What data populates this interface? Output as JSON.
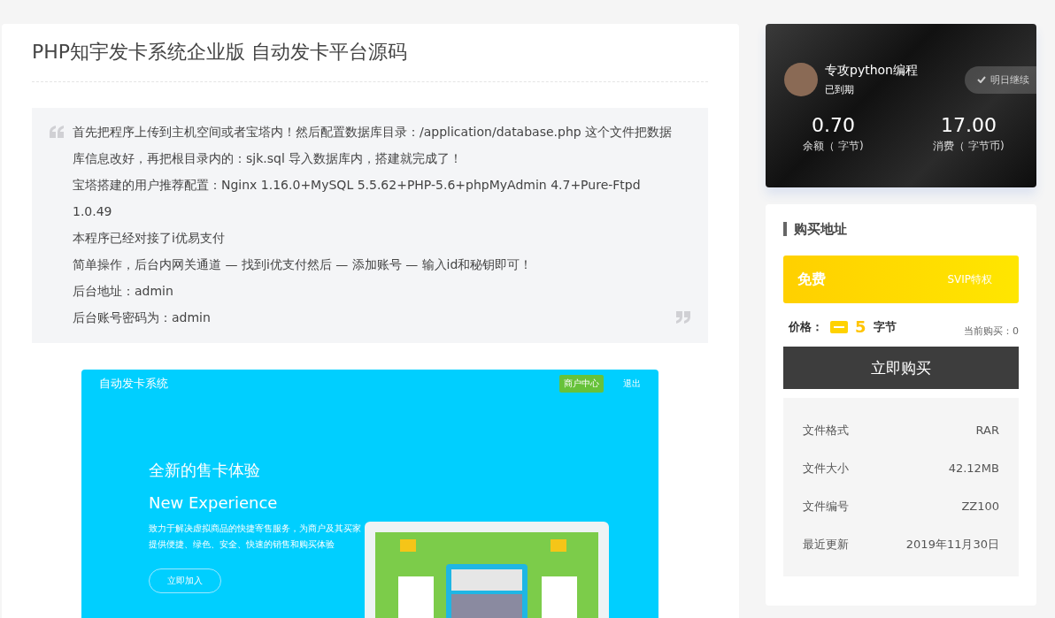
{
  "article": {
    "title": "PHP知宇发卡系统企业版 自动发卡平台源码",
    "quote_lines": [
      "首先把程序上传到主机空间或者宝塔内！然后配置数据库目录：/application/database.php 这个文件把数据库信息改好，再把根目录内的：sjk.sql 导入数据库内，搭建就完成了！",
      "宝塔搭建的用户推荐配置：Nginx 1.16.0+MySQL 5.5.62+PHP-5.6+phpMyAdmin 4.7+Pure-Ftpd 1.0.49",
      "本程序已经对接了i优易支付",
      "简单操作，后台内网关通道 — 找到i优支付然后 — 添加账号 — 输入id和秘钥即可！",
      "后台地址：admin",
      "后台账号密码为：admin"
    ],
    "shot": {
      "logo": "自动发卡系统",
      "merchant_button": "商户中心",
      "logout": "退出",
      "headline": "全新的售卡体验",
      "subheadline": "New Experience",
      "description": "致力于解决虚拟商品的快捷寄售服务，为商户及其买家提供便捷、绿色、安全、快速的销售和购买体验",
      "join_button": "立即加入"
    }
  },
  "user": {
    "name": "专攻python编程",
    "status": "已到期",
    "checkin_button": "明日继续",
    "stats": [
      {
        "value": "0.70",
        "label": "余额（ 字节)"
      },
      {
        "value": "17.00",
        "label": "消费（ 字节币)"
      }
    ]
  },
  "purchase": {
    "heading": "购买地址",
    "free_label": "免费",
    "svip_label": "SVIP特权",
    "price_label": "价格：",
    "price": "5",
    "unit": "字节",
    "bought": "当前购买：0",
    "buy_button": "立即购买",
    "file_info": [
      {
        "label": "文件格式",
        "value": "RAR"
      },
      {
        "label": "文件大小",
        "value": "42.12MB"
      },
      {
        "label": "文件编号",
        "value": "ZZ100"
      },
      {
        "label": "最近更新",
        "value": "2019年11月30日"
      }
    ]
  }
}
